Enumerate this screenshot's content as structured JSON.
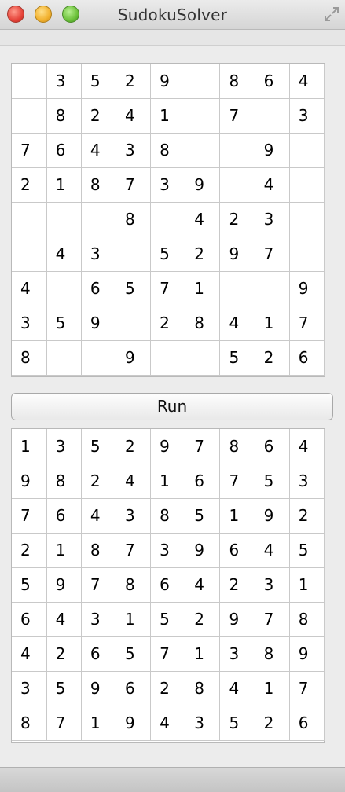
{
  "window": {
    "title": "SudokuSolver"
  },
  "input_grid": [
    [
      "",
      "3",
      "5",
      "2",
      "9",
      "",
      "8",
      "6",
      "4"
    ],
    [
      "",
      "8",
      "2",
      "4",
      "1",
      "",
      "7",
      "",
      "3"
    ],
    [
      "7",
      "6",
      "4",
      "3",
      "8",
      "",
      "",
      "9",
      ""
    ],
    [
      "2",
      "1",
      "8",
      "7",
      "3",
      "9",
      "",
      "4",
      ""
    ],
    [
      "",
      "",
      "",
      "8",
      "",
      "4",
      "2",
      "3",
      ""
    ],
    [
      "",
      "4",
      "3",
      "",
      "5",
      "2",
      "9",
      "7",
      ""
    ],
    [
      "4",
      "",
      "6",
      "5",
      "7",
      "1",
      "",
      "",
      "9"
    ],
    [
      "3",
      "5",
      "9",
      "",
      "2",
      "8",
      "4",
      "1",
      "7"
    ],
    [
      "8",
      "",
      "",
      "9",
      "",
      "",
      "5",
      "2",
      "6"
    ]
  ],
  "run_button": {
    "label": "Run"
  },
  "solution_grid": [
    [
      "1",
      "3",
      "5",
      "2",
      "9",
      "7",
      "8",
      "6",
      "4"
    ],
    [
      "9",
      "8",
      "2",
      "4",
      "1",
      "6",
      "7",
      "5",
      "3"
    ],
    [
      "7",
      "6",
      "4",
      "3",
      "8",
      "5",
      "1",
      "9",
      "2"
    ],
    [
      "2",
      "1",
      "8",
      "7",
      "3",
      "9",
      "6",
      "4",
      "5"
    ],
    [
      "5",
      "9",
      "7",
      "8",
      "6",
      "4",
      "2",
      "3",
      "1"
    ],
    [
      "6",
      "4",
      "3",
      "1",
      "5",
      "2",
      "9",
      "7",
      "8"
    ],
    [
      "4",
      "2",
      "6",
      "5",
      "7",
      "1",
      "3",
      "8",
      "9"
    ],
    [
      "3",
      "5",
      "9",
      "6",
      "2",
      "8",
      "4",
      "1",
      "7"
    ],
    [
      "8",
      "7",
      "1",
      "9",
      "4",
      "3",
      "5",
      "2",
      "6"
    ]
  ],
  "icons": {
    "close": "close-button-icon",
    "minimize": "minimize-button-icon",
    "maximize": "zoom-button-icon",
    "fullscreen": "fullscreen-arrows-icon"
  },
  "colors": {
    "close": "#e6443a",
    "minimize": "#f2b12e",
    "maximize": "#6cc13a"
  }
}
